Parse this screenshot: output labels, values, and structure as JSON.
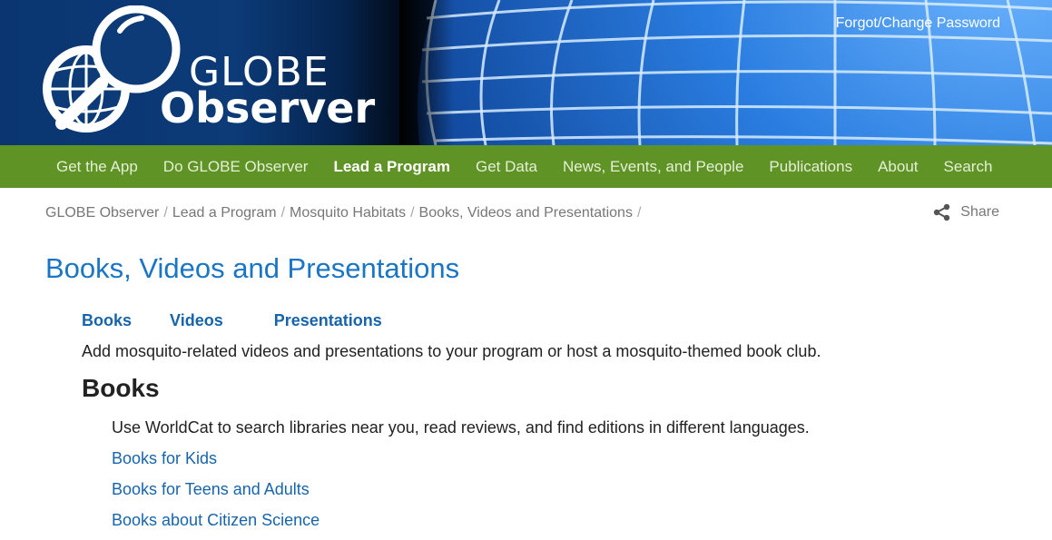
{
  "header": {
    "logo_globe": "GLOBE",
    "logo_observer": "Observer",
    "forgot_password": "Forgot/Change Password"
  },
  "nav": {
    "items": [
      {
        "label": "Get the App"
      },
      {
        "label": "Do GLOBE Observer"
      },
      {
        "label": "Lead a Program",
        "active": true
      },
      {
        "label": "Get Data"
      },
      {
        "label": "News, Events, and People"
      },
      {
        "label": "Publications"
      },
      {
        "label": "About"
      },
      {
        "label": "Search"
      }
    ]
  },
  "breadcrumb": {
    "items": [
      "GLOBE Observer",
      "Lead a Program",
      "Mosquito Habitats",
      "Books, Videos and Presentations"
    ],
    "separator": "/"
  },
  "share": {
    "label": "Share",
    "icon": "share-icon"
  },
  "main": {
    "title": "Books, Videos and Presentations",
    "tabs": [
      "Books",
      "Videos",
      "Presentations"
    ],
    "intro": "Add mosquito-related videos and presentations to your program or host a mosquito-themed book club.",
    "section_heading": "Books",
    "section_desc": "Use WorldCat to search libraries near you, read reviews, and find editions in different languages.",
    "book_links": [
      "Books for Kids",
      "Books for Teens and Adults",
      "Books about Citizen Science"
    ]
  },
  "colors": {
    "nav_bg": "#5f9326",
    "link": "#1864ab",
    "title": "#1a75c4",
    "header_bg": "#0a3570"
  }
}
